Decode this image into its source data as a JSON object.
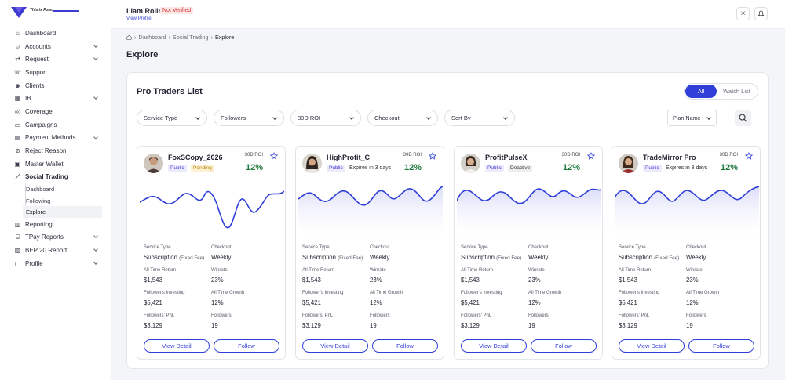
{
  "brand": {
    "name": "This is Forex"
  },
  "sidebar": {
    "items": [
      {
        "label": "Dashboard",
        "icon": "home-icon"
      },
      {
        "label": "Accounts",
        "icon": "users-icon",
        "chevron": true
      },
      {
        "label": "Request",
        "icon": "request-icon",
        "chevron": true
      },
      {
        "label": "Support",
        "icon": "support-icon"
      },
      {
        "label": "Clients",
        "icon": "clients-icon"
      },
      {
        "label": "IB",
        "icon": "ib-icon",
        "chevron": true
      },
      {
        "label": "Coverage",
        "icon": "coverage-icon"
      },
      {
        "label": "Campaigns",
        "icon": "campaigns-icon"
      },
      {
        "label": "Payment Methods",
        "icon": "payment-icon",
        "chevron": true
      },
      {
        "label": "Reject Reason",
        "icon": "reject-icon"
      },
      {
        "label": "Master Wallet",
        "icon": "wallet-icon"
      },
      {
        "label": "Social Trading",
        "icon": "chart-icon"
      }
    ],
    "social_sub": [
      {
        "label": "Dashboard"
      },
      {
        "label": "Following"
      },
      {
        "label": "Explore"
      }
    ],
    "items_after": [
      {
        "label": "Reporting",
        "icon": "reporting-icon"
      },
      {
        "label": "TPay Reports",
        "icon": "tpay-icon",
        "chevron": true
      },
      {
        "label": "BEP 20 Report",
        "icon": "bep-icon",
        "chevron": true
      },
      {
        "label": "Profile",
        "icon": "profile-icon",
        "chevron": true
      }
    ]
  },
  "header": {
    "user_name": "Liam Rolin",
    "status": "Not Verified",
    "view_profile": "View Profile"
  },
  "breadcrumb": [
    "Dashboard",
    "Social Trading",
    "Explore"
  ],
  "page_title": "Explore",
  "panel": {
    "title": "Pro Traders List",
    "tabs": [
      "All",
      "Watch List"
    ],
    "filters": [
      "Service Type",
      "Followers",
      "30D ROI",
      "Checkout",
      "Sort By"
    ],
    "plan_name": "Plan Name"
  },
  "labels": {
    "roi": "30D ROI",
    "service_type": "Service Type",
    "checkout": "Checkout",
    "all_time_return": "All Time Return",
    "winrate": "Winrate",
    "followers_investing": "Follower's Investing",
    "all_time_growth": "All Time Growth",
    "followers_pnl": "Followers' PnL",
    "followers": "Followers",
    "view_detail": "View Detail",
    "follow": "Follow"
  },
  "traders": [
    {
      "name": "FoxSCopy_2026",
      "visibility": "Public",
      "status": "Pending",
      "roi": "12%",
      "service": "Subscription",
      "service_note": "(Fixed Fee)",
      "checkout": "Weekly",
      "return": "$1,543",
      "winrate": "23%",
      "investing": "$5,421",
      "growth": "12%",
      "pnl": "$3,129",
      "followers": "19"
    },
    {
      "name": "HighProfit_C",
      "visibility": "Public",
      "status": "Expires in 3 days",
      "roi": "12%",
      "service": "Subscription",
      "service_note": "(Fixed Fee)",
      "checkout": "Weekly",
      "return": "$1,543",
      "winrate": "23%",
      "investing": "$5,421",
      "growth": "12%",
      "pnl": "$3,129",
      "followers": "19"
    },
    {
      "name": "ProfitPulseX",
      "visibility": "Public",
      "status": "Deactive",
      "roi": "12%",
      "service": "Subscription",
      "service_note": "(Fixed Fee)",
      "checkout": "Weekly",
      "return": "$1,543",
      "winrate": "23%",
      "investing": "$5,421",
      "growth": "12%",
      "pnl": "$3,129",
      "followers": "19"
    },
    {
      "name": "TradeMirror Pro",
      "visibility": "Public",
      "status": "Expires in 3 days",
      "roi": "12%",
      "service": "Subscription",
      "service_note": "(Fixed Fee)",
      "checkout": "Weekly",
      "return": "$1,543",
      "winrate": "23%",
      "investing": "$5,421",
      "growth": "12%",
      "pnl": "$3,129",
      "followers": "19"
    }
  ],
  "colors": {
    "accent": "#2f3fd8",
    "roi_green": "#1f7a3d",
    "not_verified": "#d62c2c"
  }
}
